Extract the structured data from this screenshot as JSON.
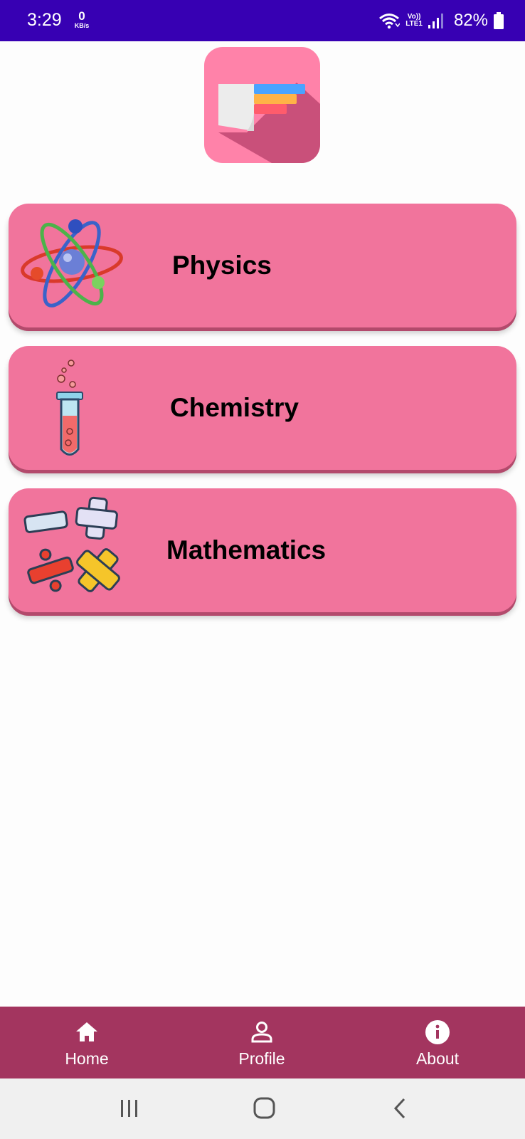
{
  "status_bar": {
    "time": "3:29",
    "net_speed_value": "0",
    "net_speed_unit": "KB/s",
    "volte_top": "Vo))",
    "volte_bottom": "LTE1",
    "battery": "82%",
    "icons": [
      "wifi-icon",
      "signal-icon",
      "battery-icon"
    ]
  },
  "app_logo": {
    "icon": "book-logo-icon",
    "bg_color": "#ff82a9"
  },
  "subjects": [
    {
      "label": "Physics",
      "icon": "atom-icon"
    },
    {
      "label": "Chemistry",
      "icon": "test-tube-icon"
    },
    {
      "label": "Mathematics",
      "icon": "math-symbols-icon"
    }
  ],
  "colors": {
    "status_bar": "#3700b3",
    "card": "#f1749c",
    "bottom_nav": "#a3355f"
  },
  "bottom_nav": {
    "items": [
      {
        "label": "Home",
        "icon": "home-icon"
      },
      {
        "label": "Profile",
        "icon": "person-icon"
      },
      {
        "label": "About",
        "icon": "info-icon"
      }
    ]
  },
  "system_nav": {
    "buttons": [
      "recents-button",
      "home-button",
      "back-button"
    ]
  }
}
